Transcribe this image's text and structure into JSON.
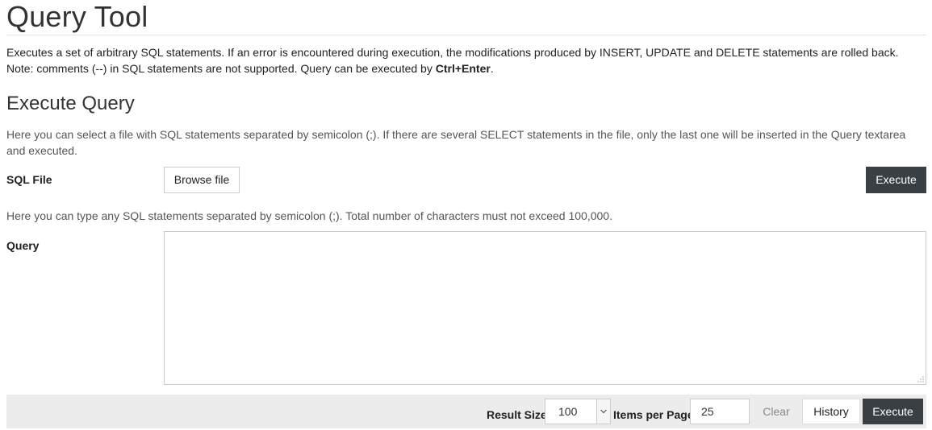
{
  "page": {
    "title": "Query Tool",
    "intro_text": "Executes a set of arbitrary SQL statements. If an error is encountered during execution, the modifications produced by INSERT, UPDATE and DELETE statements are rolled back. Note: comments (--) in SQL statements are not supported. Query can be executed by ",
    "intro_shortcut": "Ctrl+Enter",
    "intro_suffix": "."
  },
  "execute_section": {
    "title": "Execute Query",
    "file_help": "Here you can select a file with SQL statements separated by semicolon (;). If there are several SELECT statements in the file, only the last one will be inserted in the Query textarea and executed.",
    "sql_file_label": "SQL File",
    "browse_label": "Browse file",
    "execute_label": "Execute",
    "query_help": "Here you can type any SQL statements separated by semicolon (;). Total number of characters must not exceed 100,000.",
    "query_label": "Query",
    "query_value": ""
  },
  "footer": {
    "result_size_label": "Result Size",
    "result_size_value": "100",
    "items_per_page_label": "Items per Page",
    "items_per_page_value": "25",
    "clear_label": "Clear",
    "history_label": "History",
    "execute_label": "Execute"
  },
  "colors": {
    "button_dark": "#3a3f44",
    "footer_bg": "#ececec"
  }
}
